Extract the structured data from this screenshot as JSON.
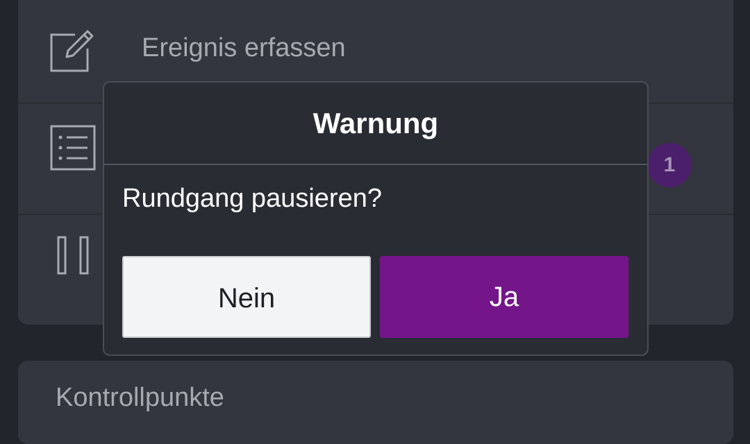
{
  "menu": {
    "items": [
      {
        "label": "Ereignis erfassen",
        "icon": "edit-icon"
      },
      {
        "label": "",
        "icon": "list-icon",
        "badge": "1"
      },
      {
        "label": "",
        "icon": "pause-icon"
      }
    ]
  },
  "section": {
    "title": "Kontrollpunkte"
  },
  "dialog": {
    "title": "Warnung",
    "message": "Rundgang pausieren?",
    "no_label": "Nein",
    "yes_label": "Ja"
  },
  "colors": {
    "accent": "#74168a",
    "badge": "#4b1f6b",
    "dialog_bg": "#2a2c34",
    "card_bg": "#33363e",
    "screen_bg": "#23252c"
  }
}
